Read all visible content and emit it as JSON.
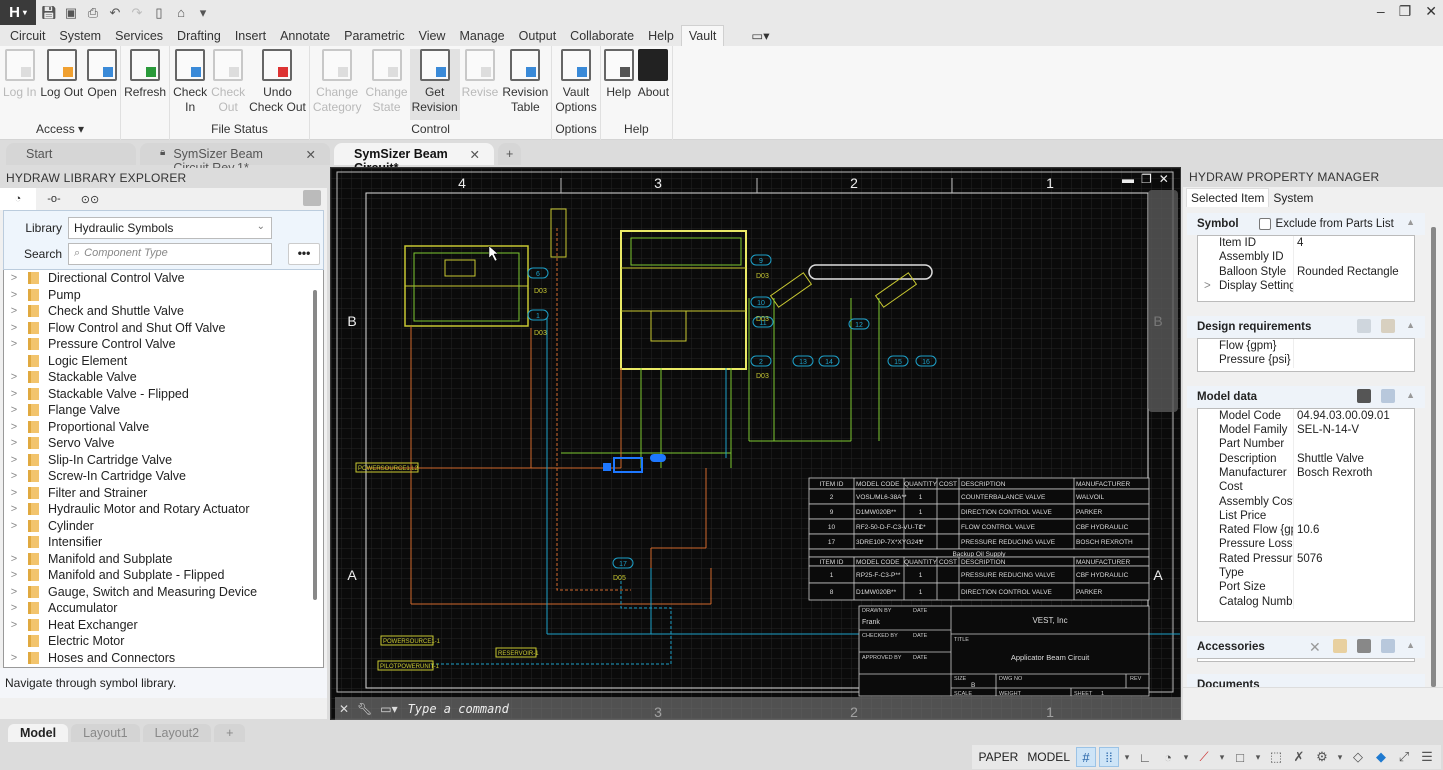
{
  "qat": {
    "app_button": "H",
    "icons": [
      "save-icon",
      "save-as-icon",
      "print-icon",
      "undo-icon",
      "redo-icon",
      "new-icon",
      "open-icon",
      "customize-icon"
    ]
  },
  "window": {
    "minimize": "–",
    "restore": "❐",
    "close": "✕"
  },
  "menu": {
    "tabs": [
      "Circuit",
      "System",
      "Services",
      "Drafting",
      "Insert",
      "Annotate",
      "Parametric",
      "View",
      "Manage",
      "Output",
      "Collaborate",
      "Help",
      "Vault"
    ],
    "active": "Vault"
  },
  "ribbon": {
    "groups": [
      {
        "label": "Access ▾",
        "buttons": [
          {
            "l1": "Log In",
            "l2": "",
            "disabled": true
          },
          {
            "l1": "Log Out",
            "l2": "",
            "disabled": false
          },
          {
            "l1": "Open",
            "l2": "",
            "disabled": false
          }
        ]
      },
      {
        "label": "",
        "buttons": [
          {
            "l1": "Refresh",
            "l2": "",
            "disabled": false
          }
        ]
      },
      {
        "label": "File Status",
        "buttons": [
          {
            "l1": "Check",
            "l2": "In",
            "disabled": false
          },
          {
            "l1": "Check",
            "l2": "Out",
            "disabled": true
          },
          {
            "l1": "Undo",
            "l2": "Check Out",
            "disabled": false
          }
        ]
      },
      {
        "label": "Control",
        "buttons": [
          {
            "l1": "Change",
            "l2": "Category",
            "disabled": true
          },
          {
            "l1": "Change",
            "l2": "State",
            "disabled": true
          },
          {
            "l1": "Get",
            "l2": "Revision",
            "disabled": false,
            "selected": true
          },
          {
            "l1": "Revise",
            "l2": "",
            "disabled": true
          },
          {
            "l1": "Revision",
            "l2": "Table",
            "disabled": false
          }
        ]
      },
      {
        "label": "Options",
        "buttons": [
          {
            "l1": "Vault",
            "l2": "Options",
            "disabled": false
          }
        ]
      },
      {
        "label": "Help",
        "buttons": [
          {
            "l1": "Help",
            "l2": "",
            "disabled": false
          },
          {
            "l1": "About",
            "l2": "",
            "disabled": false
          }
        ]
      }
    ]
  },
  "doc_tabs": [
    {
      "label": "Start",
      "active": false,
      "closable": false,
      "locked": false
    },
    {
      "label": "SymSizer Beam Circuit Rev.1*",
      "active": false,
      "closable": true,
      "locked": true
    },
    {
      "label": "SymSizer Beam Circuit*",
      "active": true,
      "closable": true,
      "locked": false
    }
  ],
  "new_tab": "+",
  "library_explorer": {
    "title": "HYDRAW LIBRARY EXPLORER",
    "library_label": "Library",
    "library_value": "Hydraulic Symbols",
    "search_label": "Search",
    "search_placeholder": "Component Type",
    "more_button": "•••",
    "items": [
      {
        "label": "Directional Control Valve",
        "expandable": true
      },
      {
        "label": "Pump",
        "expandable": true
      },
      {
        "label": "Check and Shuttle Valve",
        "expandable": true
      },
      {
        "label": "Flow Control and Shut Off Valve",
        "expandable": true
      },
      {
        "label": "Pressure Control Valve",
        "expandable": true
      },
      {
        "label": "Logic Element",
        "expandable": false
      },
      {
        "label": "Stackable Valve",
        "expandable": true
      },
      {
        "label": "Stackable Valve - Flipped",
        "expandable": true
      },
      {
        "label": "Flange Valve",
        "expandable": true
      },
      {
        "label": "Proportional Valve",
        "expandable": true
      },
      {
        "label": "Servo Valve",
        "expandable": true
      },
      {
        "label": "Slip-In Cartridge Valve",
        "expandable": true
      },
      {
        "label": "Screw-In Cartridge Valve",
        "expandable": true
      },
      {
        "label": "Filter and Strainer",
        "expandable": true
      },
      {
        "label": "Hydraulic Motor and Rotary Actuator",
        "expandable": true
      },
      {
        "label": "Cylinder",
        "expandable": true
      },
      {
        "label": "Intensifier",
        "expandable": false
      },
      {
        "label": "Manifold and Subplate",
        "expandable": true
      },
      {
        "label": "Manifold and Subplate - Flipped",
        "expandable": true
      },
      {
        "label": "Gauge, Switch and Measuring Device",
        "expandable": true
      },
      {
        "label": "Accumulator",
        "expandable": true
      },
      {
        "label": "Heat Exchanger",
        "expandable": true
      },
      {
        "label": "Electric Motor",
        "expandable": false
      },
      {
        "label": "Hoses and Connectors",
        "expandable": true
      }
    ],
    "status": "Navigate through symbol library."
  },
  "drawing": {
    "col_labels": [
      "4",
      "3",
      "2",
      "1"
    ],
    "row_labels": [
      "B",
      "A"
    ],
    "bom_headers": [
      "ITEM ID",
      "MODEL CODE",
      "QUANTITY",
      "COST",
      "DESCRIPTION",
      "MANUFACTURER"
    ],
    "bom_rows": [
      [
        "2",
        "VOSL/ML6-38A**",
        "1",
        "",
        "COUNTERBALANCE VALVE",
        "WALVOIL"
      ],
      [
        "9",
        "D1MW020B**",
        "1",
        "",
        "DIRECTION CONTROL VALVE",
        "PARKER"
      ],
      [
        "10",
        "RF2-50-D-F-C3-VU-TC*",
        "1",
        "",
        "FLOW CONTROL VALVE",
        "CBF HYDRAULIC"
      ],
      [
        "17",
        "3DRE10P-7X*XYG24**",
        "1",
        "",
        "PRESSURE REDUCING VALVE",
        "BOSCH REXROTH"
      ]
    ],
    "bom_subtitle": "Backup Oil Supply",
    "bom2_rows": [
      [
        "1",
        "RP25-F-C3-P**",
        "1",
        "",
        "PRESSURE REDUCING VALVE",
        "CBF HYDRAULIC"
      ],
      [
        "8",
        "D1MW020B**",
        "1",
        "",
        "DIRECTION CONTROL VALVE",
        "PARKER"
      ]
    ],
    "title_block": {
      "drawn_by_label": "DRAWN BY",
      "date_label": "DATE",
      "drawn_by": "Frank",
      "checked_by_label": "CHECKED BY",
      "approved_by_label": "APPROVED BY",
      "company": "VEST, Inc",
      "title_label": "TITLE",
      "title": "Applicator Beam Circuit",
      "size_label": "SIZE",
      "size": "B",
      "dwg_no_label": "DWG NO",
      "rev_label": "REV",
      "scale_label": "SCALE",
      "weight_label": "WEIGHT",
      "sheet_label": "SHEET",
      "sheet": "1"
    },
    "tags": [
      "POWERSOURCE1.L2",
      "POWERSOURCE1-1",
      "RESERVOIR-1",
      "PILOTPOWERUNIT-1",
      "PLC OUTPUT"
    ],
    "balloons": [
      "6",
      "1",
      "9",
      "10",
      "11",
      "12",
      "2",
      "13",
      "14",
      "15",
      "16",
      "17"
    ],
    "refs": [
      "D03",
      "D03",
      "D03",
      "D03",
      "D03",
      "D05"
    ]
  },
  "command": {
    "placeholder": "Type a command"
  },
  "property_manager": {
    "title": "HYDRAW PROPERTY MANAGER",
    "tabs": [
      "Selected Item",
      "System"
    ],
    "symbol": {
      "title": "Symbol",
      "exclude_label": "Exclude from Parts List",
      "exclude_checked": false,
      "rows": [
        {
          "k": "Item ID",
          "v": "4"
        },
        {
          "k": "Assembly ID",
          "v": ""
        },
        {
          "k": "Balloon Style",
          "v": "Rounded Rectangle"
        },
        {
          "k": "Display Setting",
          "v": "",
          "expandable": true
        }
      ]
    },
    "design": {
      "title": "Design requirements",
      "rows": [
        {
          "k": "Flow {gpm}",
          "v": ""
        },
        {
          "k": "Pressure {psi}",
          "v": ""
        }
      ]
    },
    "model": {
      "title": "Model data",
      "rows": [
        {
          "k": "Model Code",
          "v": "04.94.03.00.09.01"
        },
        {
          "k": "Model Family",
          "v": "SEL-N-14-V"
        },
        {
          "k": "Part Number",
          "v": ""
        },
        {
          "k": "Description",
          "v": "Shuttle Valve"
        },
        {
          "k": "Manufacturer",
          "v": "Bosch Rexroth"
        },
        {
          "k": "Cost",
          "v": ""
        },
        {
          "k": "Assembly Cost",
          "v": ""
        },
        {
          "k": "List Price",
          "v": ""
        },
        {
          "k": "Rated Flow {gp",
          "v": "10.6"
        },
        {
          "k": "Pressure Loss",
          "v": ""
        },
        {
          "k": "Rated Pressure",
          "v": "5076"
        },
        {
          "k": "Type",
          "v": ""
        },
        {
          "k": "Port Size",
          "v": ""
        },
        {
          "k": "Catalog Numbe",
          "v": ""
        }
      ]
    },
    "accessories": {
      "title": "Accessories"
    },
    "documents": {
      "title": "Documents"
    }
  },
  "layout_tabs": [
    {
      "label": "Model",
      "active": true
    },
    {
      "label": "Layout1",
      "active": false
    },
    {
      "label": "Layout2",
      "active": false
    }
  ],
  "layout_add": "+",
  "statusbar": {
    "paper": "PAPER",
    "model": "MODEL"
  },
  "colors": {
    "canvas": "#0b0b0b",
    "yellow": "#c8c832",
    "green": "#7ec832",
    "orange": "#d2692d",
    "cyan": "#1ea0c8",
    "selected": "#1e78ff"
  }
}
